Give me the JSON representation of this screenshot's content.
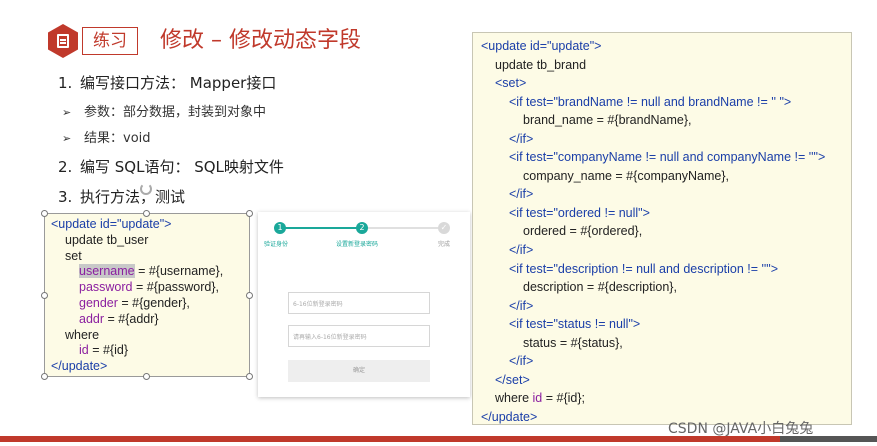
{
  "header": {
    "tag": "练习",
    "title": "修改 – 修改动态字段"
  },
  "outline": {
    "items": [
      {
        "num": "1.",
        "text": "编写接口方法： Mapper接口"
      },
      {
        "num": "2.",
        "text": "编写 SQL语句： SQL映射文件"
      },
      {
        "num": "3.",
        "text": "执行方法，测试"
      }
    ],
    "bullets": [
      {
        "arrow": "➢",
        "text": "参数：部分数据，封装到对象中"
      },
      {
        "arrow": "➢",
        "text": "结果：void"
      }
    ]
  },
  "left_code": {
    "l1a": "<update id=",
    "l1b": "\"update\">",
    "l2": "update tb_user",
    "l3": "set",
    "l4a": "username",
    "l4b": " = #{username},",
    "l5a": "password",
    "l5b": " = #{password},",
    "l6a": "gender",
    "l6b": " = #{gender},",
    "l7a": "addr",
    "l7b": " = #{addr}",
    "l8": "where",
    "l9a": "id",
    "l9b": " = #{id}",
    "l10": "</update>"
  },
  "form_mock": {
    "step1_num": "1",
    "step2_num": "2",
    "step3_num": "✓",
    "step1_label": "验证身份",
    "step2_label": "设置新登录密码",
    "step3_label": "完成",
    "input1_placeholder": "6-16位新登录密码",
    "input2_placeholder": "请再输入6-16位新登录密码",
    "button_label": "确定"
  },
  "right_code": {
    "r1a": "<update id=",
    "r1b": "\"update\">",
    "r2": "update tb_brand",
    "r3": "<set>",
    "r4a": "<if test=",
    "r4b": "\"brandName != null and brandName != '' \">",
    "r5": "brand_name = #{brandName},",
    "r6": "</if>",
    "r7a": "<if test=",
    "r7b": "\"companyName != null and companyName != ''\">",
    "r8": "company_name = #{companyName},",
    "r9": "</if>",
    "r10a": "<if test=",
    "r10b": "\"ordered != null\">",
    "r11": "ordered = #{ordered},",
    "r12": "</if>",
    "r13a": "<if test=",
    "r13b": "\"description != null and description != ''\">",
    "r14": "description = #{description},",
    "r15": "</if>",
    "r16a": "<if test=",
    "r16b": "\"status != null\">",
    "r17": "status = #{status},",
    "r18": "</if>",
    "r19": "</set>",
    "r20a": "where ",
    "r20b": "id",
    "r20c": " = #{id};",
    "r21": "</update>"
  },
  "watermark": "CSDN @JAVA小白兔兔",
  "colors": {
    "accent_red": "#c0392b",
    "code_bg": "#fdfbe6",
    "keyword_blue": "#1a3ea8",
    "field_purple": "#8b1fa0",
    "step_teal": "#1aa89a"
  }
}
